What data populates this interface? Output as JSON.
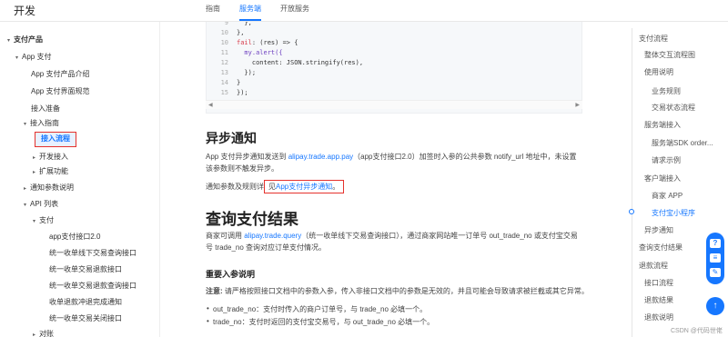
{
  "brand": "开发",
  "top_tabs": [
    "指南",
    "服务端",
    "开放服务"
  ],
  "top_tab_active": "服务端",
  "sidebar": {
    "items": [
      "支付产品",
      "App 支付",
      "App 支付产品介绍",
      "App 支付界面规范",
      "接入准备",
      "接入指南",
      "接入流程",
      "开发接入",
      "扩展功能",
      "通知参数说明",
      "API 列表",
      "支付",
      "app支付接口2.0",
      "统一收单线下交易查询接口",
      "统一收单交易退款接口",
      "统一收单交易退款查询接口",
      "收单退款冲退完成通知",
      "统一收单交易关闭接口",
      "对账"
    ],
    "active": "接入流程"
  },
  "code": {
    "lines": [
      {
        "n": "9",
        "t": "  },"
      },
      {
        "n": "10",
        "t": "},"
      },
      {
        "n": "11",
        "t": "  my.alert({"
      },
      {
        "n": "12",
        "t": "    content: JSON.stringify(res),"
      },
      {
        "n": "13",
        "t": "  });"
      },
      {
        "n": "14",
        "t": "}"
      },
      {
        "n": "15",
        "t": "});"
      }
    ],
    "fail_line": {
      "n": "10",
      "kw": "fail",
      "rest": ": (res) => {"
    }
  },
  "content": {
    "h_async": "异步通知",
    "async_p1_a": "App 支付异步通知发送到 ",
    "async_link": "alipay.trade.app.pay",
    "async_p1_b": "（app支付接口2.0）加签时入参的公共参数 notify_url 地址中，未设置该参数则不触发异步。",
    "async_p2_a": "通知参数及规则详",
    "async_p2_b": "见",
    "async_p2_link": "App支付异步通知",
    "async_p2_c": "。",
    "h_query": "查询支付结果",
    "query_p_a": "商家可调用 ",
    "query_link": "alipay.trade.query",
    "query_p_b": "（统一收单线下交易查询接口），通过商家网站唯一订单号 out_trade_no 或支付宝交易号 trade_no 查询对应订单支付情况。",
    "h_params": "重要入参说明",
    "note_label": "注意:",
    "note_text": " 请严格按照接口文档中的参数入参，传入非接口文档中的参数是无效的，并且可能会导致请求被拦截或其它异常。",
    "bullet1": "out_trade_no：支付时传入的商户订单号，与 trade_no 必填一个。",
    "bullet2": "trade_no：支付时返回的支付宝交易号，与 out_trade_no 必填一个。"
  },
  "toc": [
    "支付流程",
    "整体交互流程图",
    "使用说明",
    "业务规则",
    "交易状态流程",
    "服务端接入",
    "服务端SDK order...",
    "请求示例",
    "客户端接入",
    "商家 APP",
    "支付宝小程序",
    "异步通知",
    "查询支付结果",
    "退款流程",
    "接口流程",
    "退款结果",
    "退款说明"
  ],
  "toc_active": "支付宝小程序",
  "watermark": "CSDN @代码世佬"
}
